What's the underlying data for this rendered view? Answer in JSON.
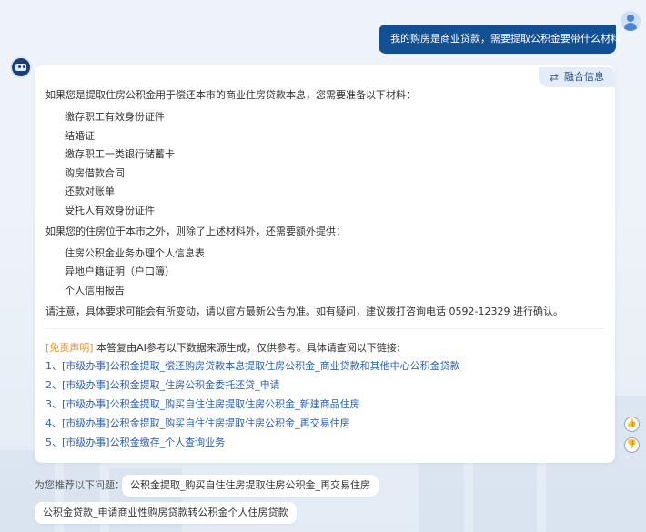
{
  "user_message": "我的购房是商业贷款，需要提取公积金要带什么材料",
  "answer": {
    "fusion_button": "融合信息",
    "intro": "如果您是提取住房公积金用于偿还本市的商业住房贷款本息，您需要准备以下材料：",
    "materials": [
      "缴存职工有效身份证件",
      "结婚证",
      "缴存职工一类银行储蓄卡",
      "购房借款合同",
      "还款对账单",
      "受托人有效身份证件"
    ],
    "outside_intro": "如果您的住房位于本市之外，则除了上述材料外，还需要额外提供：",
    "outside_materials": [
      "住房公积金业务办理个人信息表",
      "异地户籍证明（户口簿）",
      "个人信用报告"
    ],
    "notice": "请注意，具体要求可能会有所变动，请以官方最新公告为准。如有疑问，建议拨打咨询电话 0592-12329 进行确认。",
    "disclaimer_tag": "[免责声明]",
    "disclaimer_text": " 本答复由AI参考以下数据来源生成，仅供参考。具体请查阅以下链接:",
    "links": [
      "1、[市级办事]公积金提取_偿还购房贷款本息提取住房公积金_商业贷款和其他中心公积金贷款",
      "2、[市级办事]公积金提取_住房公积金委托还贷_申请",
      "3、[市级办事]公积金提取_购买自住住房提取住房公积金_新建商品住房",
      "4、[市级办事]公积金提取_购买自住住房提取住房公积金_再交易住房",
      "5、[市级办事]公积金缴存_个人查询业务"
    ]
  },
  "recommend": {
    "label": "为您推荐以下问题：",
    "questions": [
      "公积金提取_购买自住住房提取住房公积金_再交易住房",
      "公积金贷款_申请商业性购房贷款转公积金个人住房贷款"
    ]
  },
  "colors": {
    "user_bubble": "#124f93",
    "link": "#2a5fb0",
    "disclaimer_tag": "#e8912c",
    "background": "#eef3f9"
  },
  "icons": {
    "fusion": "swap-arrows-icon",
    "like": "thumbs-up-icon",
    "dislike": "thumbs-down-icon"
  }
}
